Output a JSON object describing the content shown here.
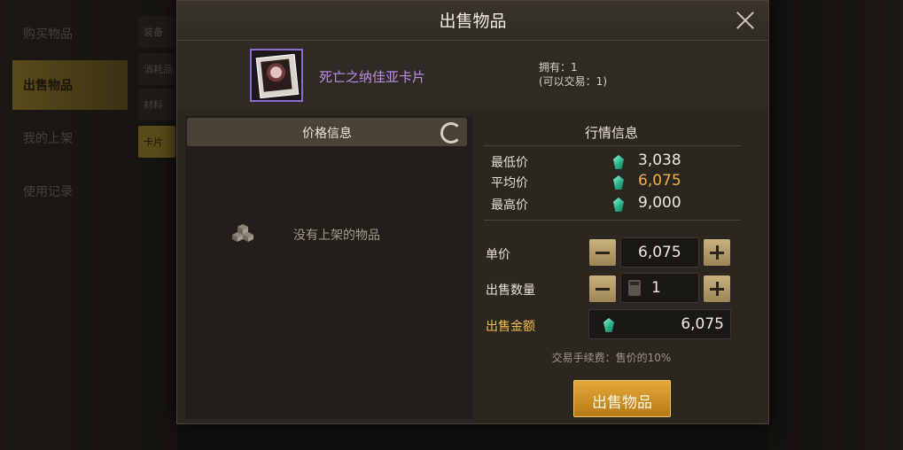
{
  "background": {
    "menu": [
      "购买物品",
      "出售物品",
      "我的上架",
      "使用记录"
    ],
    "active_menu": 1,
    "sub_tabs": [
      "装备",
      "消耗品",
      "材料",
      "卡片"
    ],
    "active_sub_tab": 3
  },
  "dialog": {
    "title": "出售物品",
    "item": {
      "name": "死亡之纳佳亚卡片",
      "owned_line": "拥有：1",
      "tradable_line": "(可以交易：1)"
    },
    "price_info": {
      "header": "价格信息",
      "empty_text": "没有上架的物品"
    },
    "market": {
      "title": "行情信息",
      "rows": [
        {
          "label": "最低价",
          "value": "3,038"
        },
        {
          "label": "平均价",
          "value": "6,075"
        },
        {
          "label": "最高价",
          "value": "9,000"
        }
      ]
    },
    "form": {
      "unit_price_label": "单价",
      "unit_price": "6,075",
      "quantity_label": "出售数量",
      "quantity": "1",
      "total_label": "出售金额",
      "total": "6,075",
      "fee_text": "交易手续费：售价的10%"
    },
    "sell_button": "出售物品"
  },
  "colors": {
    "accent_gold": "#e5a83a",
    "item_name_purple": "#b98ee6",
    "avg_price_orange": "#f0b048"
  }
}
